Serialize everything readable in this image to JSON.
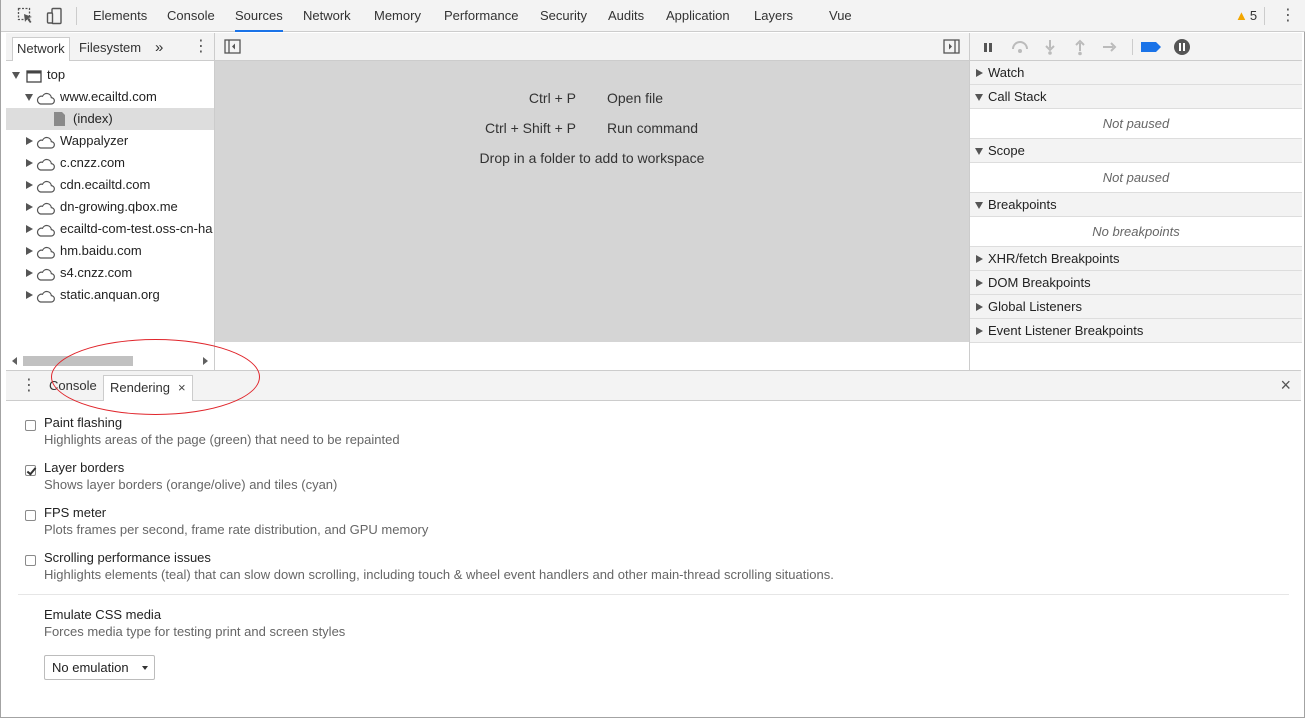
{
  "toolbar": {
    "tabs": [
      "Elements",
      "Console",
      "Sources",
      "Network",
      "Memory",
      "Performance",
      "Security",
      "Audits",
      "Application",
      "Layers",
      "Vue"
    ],
    "active_tab": "Sources",
    "warning_count": "5",
    "icons": [
      "inspect-icon",
      "device-toggle-icon",
      "warning-icon",
      "more-menu-icon"
    ]
  },
  "navigator": {
    "tabs": [
      "Network",
      "Filesystem"
    ],
    "overflow": "»",
    "tree": [
      {
        "label": "top",
        "indent": 0,
        "expanded": true,
        "icon": "frame-icon"
      },
      {
        "label": "www.ecailtd.com",
        "indent": 1,
        "expanded": true,
        "icon": "cloud-icon"
      },
      {
        "label": "(index)",
        "indent": 2,
        "file": true,
        "icon": "file-icon",
        "selected": true
      },
      {
        "label": "Wappalyzer",
        "indent": 1,
        "icon": "cloud-icon"
      },
      {
        "label": "c.cnzz.com",
        "indent": 1,
        "icon": "cloud-icon"
      },
      {
        "label": "cdn.ecailtd.com",
        "indent": 1,
        "icon": "cloud-icon"
      },
      {
        "label": "dn-growing.qbox.me",
        "indent": 1,
        "icon": "cloud-icon"
      },
      {
        "label": "ecailtd-com-test.oss-cn-ha",
        "indent": 1,
        "icon": "cloud-icon"
      },
      {
        "label": "hm.baidu.com",
        "indent": 1,
        "icon": "cloud-icon"
      },
      {
        "label": "s4.cnzz.com",
        "indent": 1,
        "icon": "cloud-icon"
      },
      {
        "label": "static.anquan.org",
        "indent": 1,
        "icon": "cloud-icon"
      }
    ]
  },
  "editor": {
    "shortcuts": [
      {
        "keys": "Ctrl + P",
        "action": "Open file"
      },
      {
        "keys": "Ctrl + Shift + P",
        "action": "Run command"
      }
    ],
    "drop_hint": "Drop in a folder to add to workspace"
  },
  "debugger": {
    "sections": [
      {
        "label": "Watch",
        "expanded": false
      },
      {
        "label": "Call Stack",
        "expanded": true,
        "body": "Not paused"
      },
      {
        "label": "Scope",
        "expanded": true,
        "body": "Not paused"
      },
      {
        "label": "Breakpoints",
        "expanded": true,
        "body": "No breakpoints"
      },
      {
        "label": "XHR/fetch Breakpoints",
        "expanded": false
      },
      {
        "label": "DOM Breakpoints",
        "expanded": false
      },
      {
        "label": "Global Listeners",
        "expanded": false
      },
      {
        "label": "Event Listener Breakpoints",
        "expanded": false
      }
    ]
  },
  "drawer": {
    "tabs": [
      "Console",
      "Rendering"
    ],
    "active_tab": "Rendering",
    "close_glyph": "×",
    "options": [
      {
        "title": "Paint flashing",
        "desc": "Highlights areas of the page (green) that need to be repainted",
        "checked": false
      },
      {
        "title": "Layer borders",
        "desc": "Shows layer borders (orange/olive) and tiles (cyan)",
        "checked": true
      },
      {
        "title": "FPS meter",
        "desc": "Plots frames per second, frame rate distribution, and GPU memory",
        "checked": false
      },
      {
        "title": "Scrolling performance issues",
        "desc": "Highlights elements (teal) that can slow down scrolling, including touch & wheel event handlers and other main-thread scrolling situations.",
        "checked": false
      }
    ],
    "media": {
      "title": "Emulate CSS media",
      "desc": "Forces media type for testing print and screen styles",
      "selected": "No emulation"
    }
  },
  "colors": {
    "accent": "#1a73e8",
    "annotation": "#e0252b",
    "warning": "#f2a600",
    "deactivate_breakpoints": "#1a73e8"
  }
}
